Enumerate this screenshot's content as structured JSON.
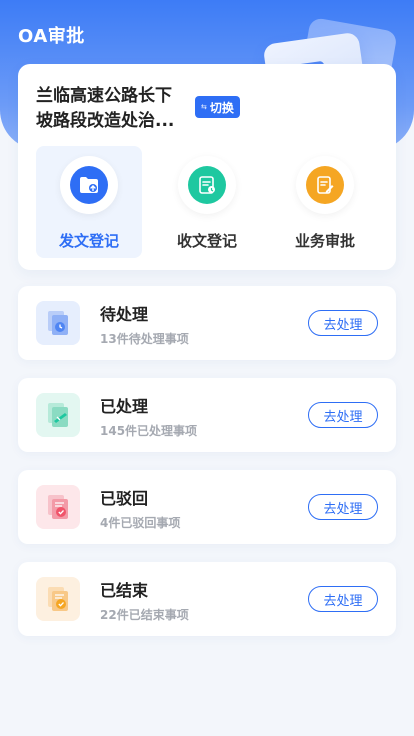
{
  "header": {
    "title": "OA审批"
  },
  "project": {
    "name": "兰临高速公路长下坡路段改造处治...",
    "switch_label": "切换",
    "switch_icon": "swap-arrows-icon"
  },
  "actions": [
    {
      "label": "发文登记",
      "icon": "folder-upload-icon",
      "color": "#2e6ef5",
      "active": true
    },
    {
      "label": "收文登记",
      "icon": "inbox-document-icon",
      "color": "#1ec8a0",
      "active": false
    },
    {
      "label": "业务审批",
      "icon": "edit-document-icon",
      "color": "#f5a623",
      "active": false
    }
  ],
  "tasks": [
    {
      "title": "待处理",
      "subtitle": "13件待处理事项",
      "button": "去处理",
      "icon": "pending-clock-icon",
      "tile_color": "#e6eefd",
      "accent": "#4f85f3"
    },
    {
      "title": "已处理",
      "subtitle": "145件已处理事项",
      "button": "去处理",
      "icon": "processed-icon",
      "tile_color": "#e3f7f1",
      "accent": "#1ec8a0"
    },
    {
      "title": "已驳回",
      "subtitle": "4件已驳回事项",
      "button": "去处理",
      "icon": "rejected-icon",
      "tile_color": "#fde7ea",
      "accent": "#f0546a"
    },
    {
      "title": "已结束",
      "subtitle": "22件已结束事项",
      "button": "去处理",
      "icon": "finished-icon",
      "tile_color": "#fdf0e0",
      "accent": "#f5a623"
    }
  ]
}
